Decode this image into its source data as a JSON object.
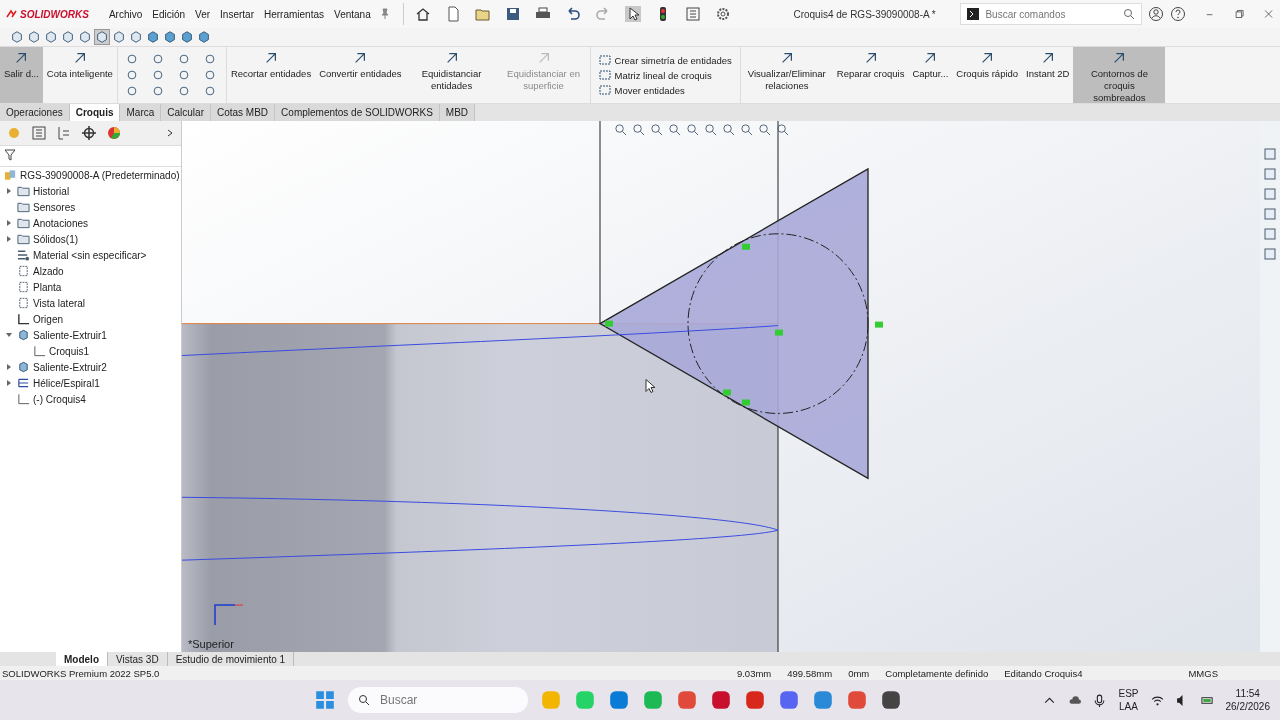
{
  "app": {
    "logo": "SOLIDWORKS",
    "menu": [
      "Archivo",
      "Edición",
      "Ver",
      "Insertar",
      "Herramientas",
      "Ventana"
    ],
    "title": "Croquis4 de RGS-39090008-A *",
    "search": {
      "placeholder": "Buscar comandos"
    }
  },
  "ribbon": {
    "commands": [
      {
        "kind": "large",
        "label": "Salir d...",
        "selected": true,
        "disabled": false
      },
      {
        "kind": "large",
        "label": "Cota inteligente",
        "selected": false,
        "disabled": false
      },
      {
        "kind": "tools"
      },
      {
        "kind": "large",
        "label": "Recortar entidades",
        "selected": false,
        "disabled": false
      },
      {
        "kind": "large",
        "label": "Convertir entidades",
        "selected": false,
        "disabled": false
      },
      {
        "kind": "large",
        "label": "Equidistanciar entidades",
        "selected": false,
        "disabled": false
      },
      {
        "kind": "large",
        "label": "Equidistanciar en superficie",
        "selected": false,
        "disabled": true
      },
      {
        "kind": "stack",
        "items": [
          "Crear simetría de entidades",
          "Matriz lineal de croquis",
          "Mover entidades"
        ]
      },
      {
        "kind": "large",
        "label": "Visualizar/Eliminar relaciones",
        "selected": false,
        "disabled": false
      },
      {
        "kind": "large",
        "label": "Reparar croquis",
        "selected": false,
        "disabled": false
      },
      {
        "kind": "large",
        "label": "Captur...",
        "selected": false,
        "disabled": false
      },
      {
        "kind": "large",
        "label": "Croquis rápido",
        "selected": false,
        "disabled": false
      },
      {
        "kind": "large",
        "label": "Instant 2D",
        "selected": false,
        "disabled": false
      },
      {
        "kind": "large",
        "label": "Contornos de croquis sombreados",
        "selected": true,
        "disabled": false
      }
    ]
  },
  "command_tabs": [
    {
      "label": "Operaciones",
      "selected": false
    },
    {
      "label": "Croquis",
      "selected": true
    },
    {
      "label": "Marca",
      "selected": false
    },
    {
      "label": "Calcular",
      "selected": false
    },
    {
      "label": "Cotas MBD",
      "selected": false
    },
    {
      "label": "Complementos de SOLIDWORKS",
      "selected": false
    },
    {
      "label": "MBD",
      "selected": false
    }
  ],
  "feature_tree": {
    "root": {
      "label": "RGS-39090008-A (Predeterminado)",
      "children": [
        {
          "label": "Historial",
          "kind": "folder",
          "expanded": false
        },
        {
          "label": "Sensores",
          "kind": "folder"
        },
        {
          "label": "Anotaciones",
          "kind": "folder",
          "expanded": false
        },
        {
          "label": "Sólidos(1)",
          "kind": "folder",
          "expanded": false
        },
        {
          "label": "Material <sin especificar>",
          "kind": "material"
        },
        {
          "label": "Alzado",
          "kind": "plane"
        },
        {
          "label": "Planta",
          "kind": "plane"
        },
        {
          "label": "Vista lateral",
          "kind": "plane"
        },
        {
          "label": "Origen",
          "kind": "origin"
        },
        {
          "label": "Saliente-Extruir1",
          "kind": "feature",
          "expanded": true,
          "children": [
            {
              "label": "Croquis1",
              "kind": "sketch"
            }
          ]
        },
        {
          "label": "Saliente-Extruir2",
          "kind": "feature",
          "expanded": false
        },
        {
          "label": "Hélice/Espiral1",
          "kind": "helix",
          "expanded": false
        },
        {
          "label": "(-) Croquis4",
          "kind": "sketch"
        }
      ]
    }
  },
  "viewport": {
    "view_label": "*Superior"
  },
  "bottom_tabs": [
    {
      "label": "Modelo",
      "selected": true
    },
    {
      "label": "Vistas 3D",
      "selected": false
    },
    {
      "label": "Estudio de movimiento 1",
      "selected": false
    }
  ],
  "status_bar": {
    "product": "SOLIDWORKS Premium 2022 SP5.0",
    "x": "9.03mm",
    "y": "499.58mm",
    "z": "0mm",
    "state": "Completamente definido",
    "mode": "Editando Croquis4",
    "units": "MMGS"
  },
  "taskbar": {
    "search": {
      "placeholder": "Buscar"
    },
    "language": "ESP",
    "layout": "LAA",
    "time": "11:54",
    "date": "26/2/2026"
  }
}
